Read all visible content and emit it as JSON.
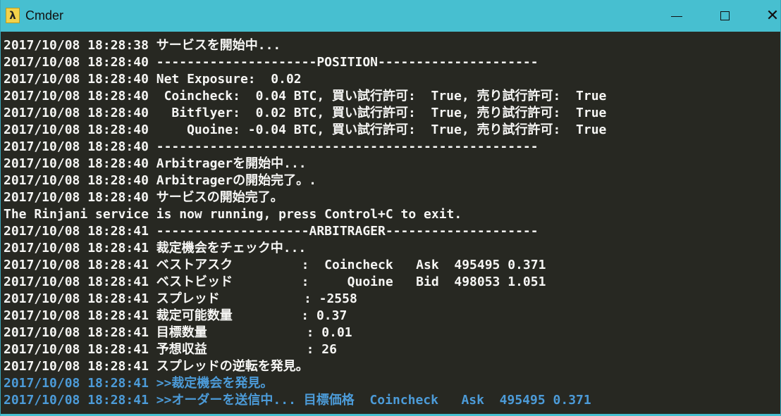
{
  "window": {
    "title": "Cmder",
    "icon": "lambda-icon",
    "icon_glyph": "λ",
    "controls": {
      "minimize": "minimize-icon",
      "maximize": "maximize-icon",
      "close": "close-icon"
    },
    "accent_color": "#47bfd0",
    "background_color": "#272822"
  },
  "console": {
    "lines": [
      "2017/10/08 18:28:38 サービスを開始中...",
      "2017/10/08 18:28:40 ---------------------POSITION---------------------",
      "2017/10/08 18:28:40 Net Exposure:  0.02",
      "2017/10/08 18:28:40  Coincheck:  0.04 BTC, 買い試行許可:  True, 売り試行許可:  True",
      "2017/10/08 18:28:40   Bitflyer:  0.02 BTC, 買い試行許可:  True, 売り試行許可:  True",
      "2017/10/08 18:28:40     Quoine: -0.04 BTC, 買い試行許可:  True, 売り試行許可:  True",
      "2017/10/08 18:28:40 --------------------------------------------------",
      "2017/10/08 18:28:40 Arbitragerを開始中...",
      "2017/10/08 18:28:40 Arbitragerの開始完了。.",
      "2017/10/08 18:28:40 サービスの開始完了。",
      "The Rinjani service is now running, press Control+C to exit.",
      "2017/10/08 18:28:41 --------------------ARBITRAGER--------------------",
      "2017/10/08 18:28:41 裁定機会をチェック中...",
      "2017/10/08 18:28:41 ベストアスク         :  Coincheck   Ask  495495 0.371",
      "2017/10/08 18:28:41 ベストビッド         :     Quoine   Bid  498053 1.051",
      "2017/10/08 18:28:41 スプレッド           : -2558",
      "2017/10/08 18:28:41 裁定可能数量         : 0.37",
      "2017/10/08 18:28:41 目標数量             : 0.01",
      "2017/10/08 18:28:41 予想収益             : 26",
      "2017/10/08 18:28:41 スプレッドの逆転を発見。",
      "2017/10/08 18:28:41 >>裁定機会を発見。",
      "2017/10/08 18:28:41 >>オーダーを送信中... 目標価格  Coincheck   Ask  495495 0.371"
    ],
    "highlight_color": "#4c9bd8",
    "text_color": "#f6f6f4"
  }
}
